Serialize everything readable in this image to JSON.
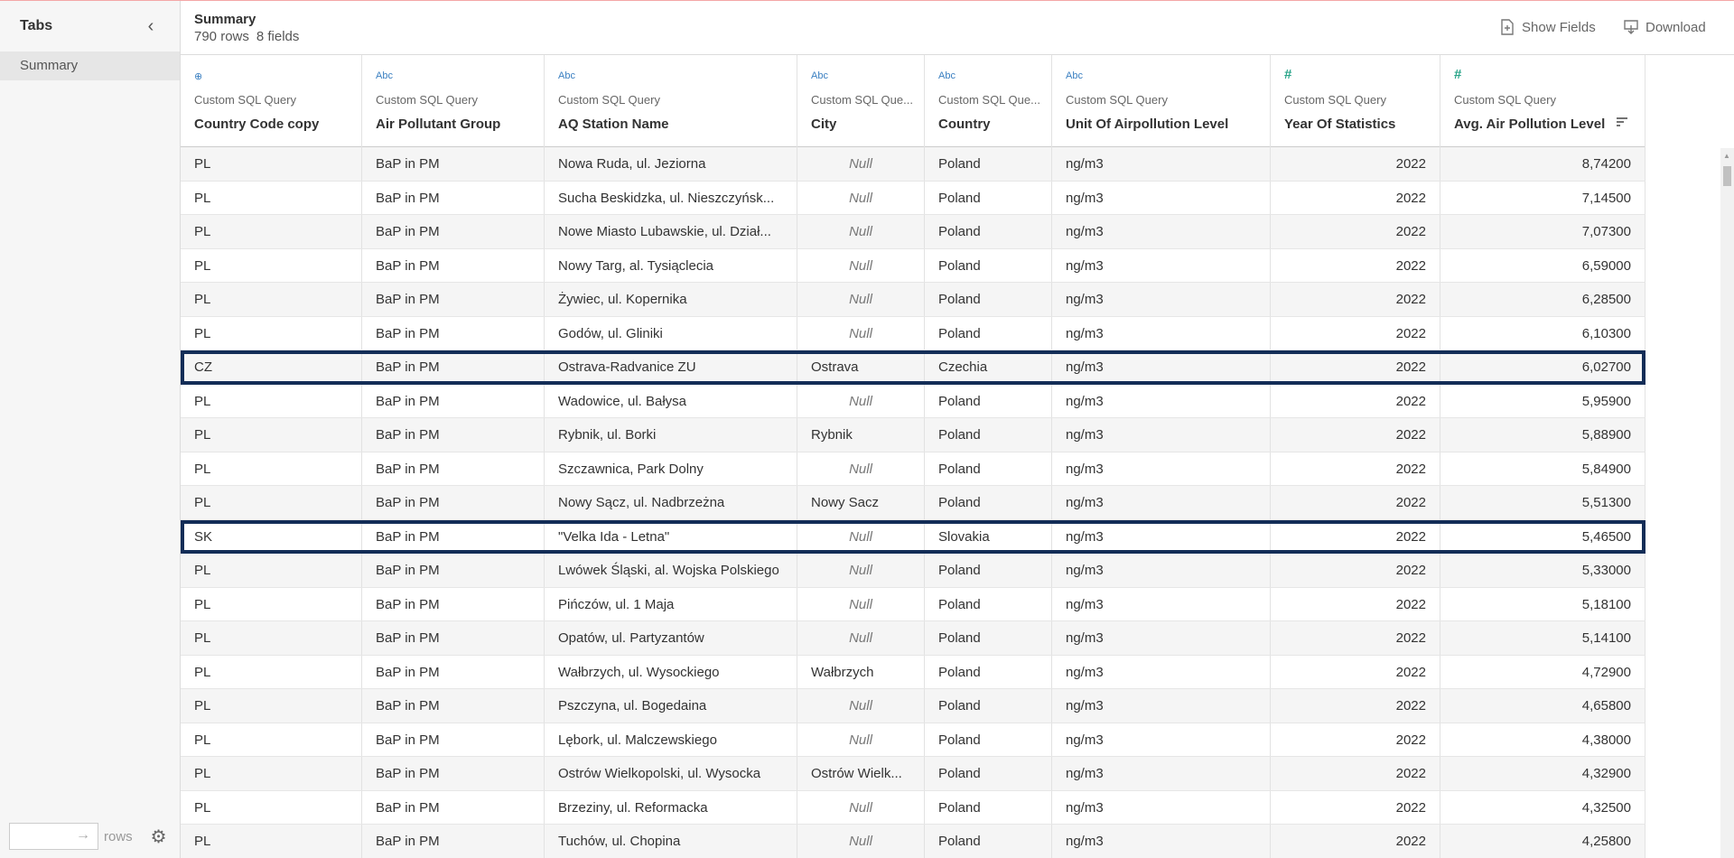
{
  "sidebar": {
    "title": "Tabs",
    "tabs": [
      {
        "label": "Summary"
      }
    ],
    "rows_label": "rows"
  },
  "header": {
    "title": "Summary",
    "rows_count": "790 rows",
    "fields_count": "8 fields",
    "show_fields_label": "Show Fields",
    "download_label": "Download"
  },
  "columns": [
    {
      "type": "geo",
      "type_label": "⊕",
      "source": "Custom SQL Query",
      "name": "Country Code copy"
    },
    {
      "type": "text",
      "type_label": "Abc",
      "source": "Custom SQL Query",
      "name": "Air Pollutant Group"
    },
    {
      "type": "text",
      "type_label": "Abc",
      "source": "Custom SQL Query",
      "name": "AQ Station Name"
    },
    {
      "type": "text",
      "type_label": "Abc",
      "source": "Custom SQL Que...",
      "name": "City"
    },
    {
      "type": "text",
      "type_label": "Abc",
      "source": "Custom SQL Que...",
      "name": "Country"
    },
    {
      "type": "text",
      "type_label": "Abc",
      "source": "Custom SQL Query",
      "name": "Unit Of Airpollution Level"
    },
    {
      "type": "number",
      "type_label": "#",
      "source": "Custom SQL Query",
      "name": "Year Of Statistics"
    },
    {
      "type": "number",
      "type_label": "#",
      "source": "Custom SQL Query",
      "name": "Avg. Air Pollution Level"
    }
  ],
  "rows": [
    {
      "code": "PL",
      "group": "BaP in PM",
      "station": "Nowa Ruda, ul. Jeziorna",
      "city": "Null",
      "country": "Poland",
      "unit": "ng/m3",
      "year": "2022",
      "value": "8,74200",
      "highlight": false
    },
    {
      "code": "PL",
      "group": "BaP in PM",
      "station": "Sucha Beskidzka, ul. Nieszczyńsk...",
      "city": "Null",
      "country": "Poland",
      "unit": "ng/m3",
      "year": "2022",
      "value": "7,14500",
      "highlight": false
    },
    {
      "code": "PL",
      "group": "BaP in PM",
      "station": "Nowe Miasto Lubawskie, ul. Dział...",
      "city": "Null",
      "country": "Poland",
      "unit": "ng/m3",
      "year": "2022",
      "value": "7,07300",
      "highlight": false
    },
    {
      "code": "PL",
      "group": "BaP in PM",
      "station": "Nowy Targ, al. Tysiąclecia",
      "city": "Null",
      "country": "Poland",
      "unit": "ng/m3",
      "year": "2022",
      "value": "6,59000",
      "highlight": false
    },
    {
      "code": "PL",
      "group": "BaP in PM",
      "station": "Żywiec, ul. Kopernika",
      "city": "Null",
      "country": "Poland",
      "unit": "ng/m3",
      "year": "2022",
      "value": "6,28500",
      "highlight": false
    },
    {
      "code": "PL",
      "group": "BaP in PM",
      "station": "Godów, ul. Gliniki",
      "city": "Null",
      "country": "Poland",
      "unit": "ng/m3",
      "year": "2022",
      "value": "6,10300",
      "highlight": false
    },
    {
      "code": "CZ",
      "group": "BaP in PM",
      "station": "Ostrava-Radvanice ZU",
      "city": "Ostrava",
      "country": "Czechia",
      "unit": "ng/m3",
      "year": "2022",
      "value": "6,02700",
      "highlight": true
    },
    {
      "code": "PL",
      "group": "BaP in PM",
      "station": "Wadowice, ul. Bałysa",
      "city": "Null",
      "country": "Poland",
      "unit": "ng/m3",
      "year": "2022",
      "value": "5,95900",
      "highlight": false
    },
    {
      "code": "PL",
      "group": "BaP in PM",
      "station": "Rybnik, ul. Borki",
      "city": "Rybnik",
      "country": "Poland",
      "unit": "ng/m3",
      "year": "2022",
      "value": "5,88900",
      "highlight": false
    },
    {
      "code": "PL",
      "group": "BaP in PM",
      "station": "Szczawnica, Park Dolny",
      "city": "Null",
      "country": "Poland",
      "unit": "ng/m3",
      "year": "2022",
      "value": "5,84900",
      "highlight": false
    },
    {
      "code": "PL",
      "group": "BaP in PM",
      "station": "Nowy Sącz, ul. Nadbrzeżna",
      "city": "Nowy Sacz",
      "country": "Poland",
      "unit": "ng/m3",
      "year": "2022",
      "value": "5,51300",
      "highlight": false
    },
    {
      "code": "SK",
      "group": "BaP in PM",
      "station": "\"Velka Ida - Letna\"",
      "city": "Null",
      "country": "Slovakia",
      "unit": "ng/m3",
      "year": "2022",
      "value": "5,46500",
      "highlight": true
    },
    {
      "code": "PL",
      "group": "BaP in PM",
      "station": "Lwówek Śląski, al. Wojska Polskiego",
      "city": "Null",
      "country": "Poland",
      "unit": "ng/m3",
      "year": "2022",
      "value": "5,33000",
      "highlight": false
    },
    {
      "code": "PL",
      "group": "BaP in PM",
      "station": "Pińczów, ul. 1 Maja",
      "city": "Null",
      "country": "Poland",
      "unit": "ng/m3",
      "year": "2022",
      "value": "5,18100",
      "highlight": false
    },
    {
      "code": "PL",
      "group": "BaP in PM",
      "station": "Opatów, ul. Partyzantów",
      "city": "Null",
      "country": "Poland",
      "unit": "ng/m3",
      "year": "2022",
      "value": "5,14100",
      "highlight": false
    },
    {
      "code": "PL",
      "group": "BaP in PM",
      "station": "Wałbrzych, ul. Wysockiego",
      "city": "Wałbrzych",
      "country": "Poland",
      "unit": "ng/m3",
      "year": "2022",
      "value": "4,72900",
      "highlight": false
    },
    {
      "code": "PL",
      "group": "BaP in PM",
      "station": "Pszczyna, ul. Bogedaina",
      "city": "Null",
      "country": "Poland",
      "unit": "ng/m3",
      "year": "2022",
      "value": "4,65800",
      "highlight": false
    },
    {
      "code": "PL",
      "group": "BaP in PM",
      "station": "Lębork, ul. Malczewskiego",
      "city": "Null",
      "country": "Poland",
      "unit": "ng/m3",
      "year": "2022",
      "value": "4,38000",
      "highlight": false
    },
    {
      "code": "PL",
      "group": "BaP in PM",
      "station": "Ostrów Wielkopolski, ul. Wysocka",
      "city": "Ostrów Wielk...",
      "country": "Poland",
      "unit": "ng/m3",
      "year": "2022",
      "value": "4,32900",
      "highlight": false
    },
    {
      "code": "PL",
      "group": "BaP in PM",
      "station": "Brzeziny, ul. Reformacka",
      "city": "Null",
      "country": "Poland",
      "unit": "ng/m3",
      "year": "2022",
      "value": "4,32500",
      "highlight": false
    },
    {
      "code": "PL",
      "group": "BaP in PM",
      "station": "Tuchów, ul. Chopina",
      "city": "Null",
      "country": "Poland",
      "unit": "ng/m3",
      "year": "2022",
      "value": "4,25800",
      "highlight": false
    }
  ],
  "colors": {
    "highlight_border": "#132d57",
    "text_type_icon": "#3a7fc1",
    "number_type_icon": "#2aa58a"
  }
}
